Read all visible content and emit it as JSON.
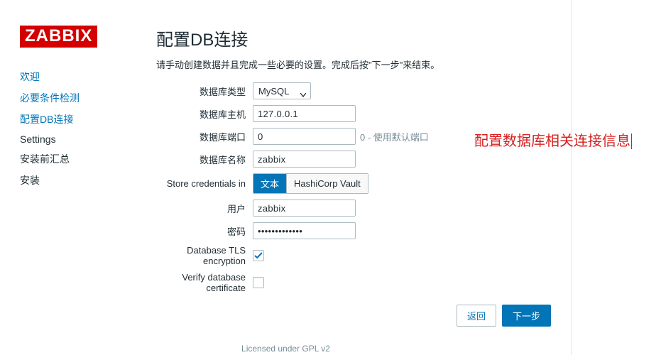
{
  "logo": "ZABBIX",
  "steps": [
    {
      "label": "欢迎",
      "state": "done"
    },
    {
      "label": "必要条件检测",
      "state": "done"
    },
    {
      "label": "配置DB连接",
      "state": "active"
    },
    {
      "label": "Settings",
      "state": "future"
    },
    {
      "label": "安装前汇总",
      "state": "future"
    },
    {
      "label": "安装",
      "state": "future"
    }
  ],
  "title": "配置DB连接",
  "subtitle": "请手动创建数据并且完成一些必要的设置。完成后按\"下一步\"来结束。",
  "form": {
    "db_type": {
      "label": "数据库类型",
      "value": "MySQL"
    },
    "db_host": {
      "label": "数据库主机",
      "value": "127.0.0.1"
    },
    "db_port": {
      "label": "数据库端口",
      "value": "0",
      "hint": "0 - 使用默认端口"
    },
    "db_name": {
      "label": "数据库名称",
      "value": "zabbix"
    },
    "store_cred": {
      "label": "Store credentials in",
      "options": [
        "文本",
        "HashiCorp Vault"
      ],
      "selected": 0
    },
    "user": {
      "label": "用户",
      "value": "zabbix"
    },
    "password": {
      "label": "密码",
      "value": "•••••••••••••"
    },
    "tls": {
      "label": "Database TLS encryption",
      "checked": true
    },
    "verify_cert": {
      "label": "Verify database certificate",
      "checked": false
    }
  },
  "buttons": {
    "back": "返回",
    "next": "下一步"
  },
  "annotation": "配置数据库相关连接信息",
  "footer": "Licensed under GPL v2"
}
